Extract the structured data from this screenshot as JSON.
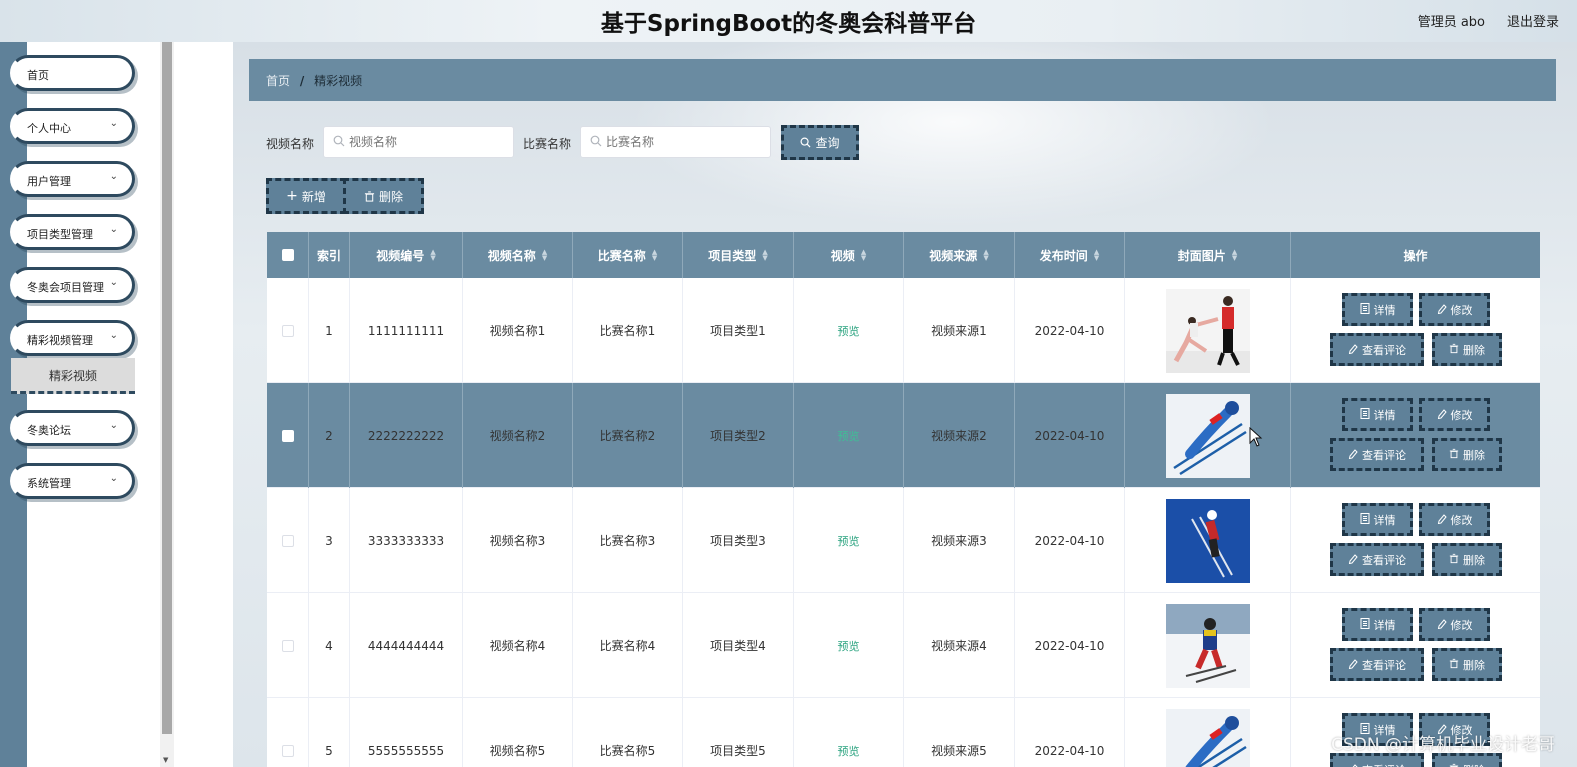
{
  "header": {
    "title": "基于SpringBoot的冬奥会科普平台",
    "user": "管理员 abo",
    "logout": "退出登录"
  },
  "sidebar": {
    "items": [
      {
        "label": "首页",
        "has_submenu": false
      },
      {
        "label": "个人中心",
        "has_submenu": true
      },
      {
        "label": "用户管理",
        "has_submenu": true
      },
      {
        "label": "项目类型管理",
        "has_submenu": true
      },
      {
        "label": "冬奥会项目管理",
        "has_submenu": true
      },
      {
        "label": "精彩视频管理",
        "has_submenu": true
      },
      {
        "label": "冬奥论坛",
        "has_submenu": true
      },
      {
        "label": "系统管理",
        "has_submenu": true
      }
    ],
    "active_sub": "精彩视频"
  },
  "breadcrumb": {
    "home": "首页",
    "sep": "/",
    "current": "精彩视频"
  },
  "search": {
    "video_name_label": "视频名称",
    "video_name_placeholder": "视频名称",
    "match_name_label": "比赛名称",
    "match_name_placeholder": "比赛名称",
    "query_label": "查询"
  },
  "toolbar": {
    "add_label": "新增",
    "delete_label": "删除"
  },
  "table": {
    "columns": [
      "索引",
      "视频编号",
      "视频名称",
      "比赛名称",
      "项目类型",
      "视频",
      "视频来源",
      "发布时间",
      "封面图片",
      "操作"
    ],
    "rows": [
      {
        "index": "1",
        "code": "1111111111",
        "name": "视频名称1",
        "match": "比赛名称1",
        "type": "项目类型1",
        "video": "预览",
        "source": "视频来源1",
        "date": "2022-04-10",
        "cover": "figure-skating"
      },
      {
        "index": "2",
        "code": "2222222222",
        "name": "视频名称2",
        "match": "比赛名称2",
        "type": "项目类型2",
        "video": "预览",
        "source": "视频来源2",
        "date": "2022-04-10",
        "cover": "ski-jump-light"
      },
      {
        "index": "3",
        "code": "3333333333",
        "name": "视频名称3",
        "match": "比赛名称3",
        "type": "项目类型3",
        "video": "预览",
        "source": "视频来源3",
        "date": "2022-04-10",
        "cover": "ski-jump-blue"
      },
      {
        "index": "4",
        "code": "4444444444",
        "name": "视频名称4",
        "match": "比赛名称4",
        "type": "项目类型4",
        "video": "预览",
        "source": "视频来源4",
        "date": "2022-04-10",
        "cover": "biathlon"
      },
      {
        "index": "5",
        "code": "5555555555",
        "name": "视频名称5",
        "match": "比赛名称5",
        "type": "项目类型5",
        "video": "预览",
        "source": "视频来源5",
        "date": "2022-04-10",
        "cover": "ski-jump-light"
      }
    ],
    "actions": {
      "detail": "详情",
      "edit": "修改",
      "comments": "查看评论",
      "delete": "删除"
    }
  },
  "watermark": "CSDN @计算机毕业设计老哥",
  "colors": {
    "primary": "#5f8199",
    "header_row": "#6a8ba1",
    "border_dark": "#1f3647",
    "preview_link": "#2aa37f"
  }
}
